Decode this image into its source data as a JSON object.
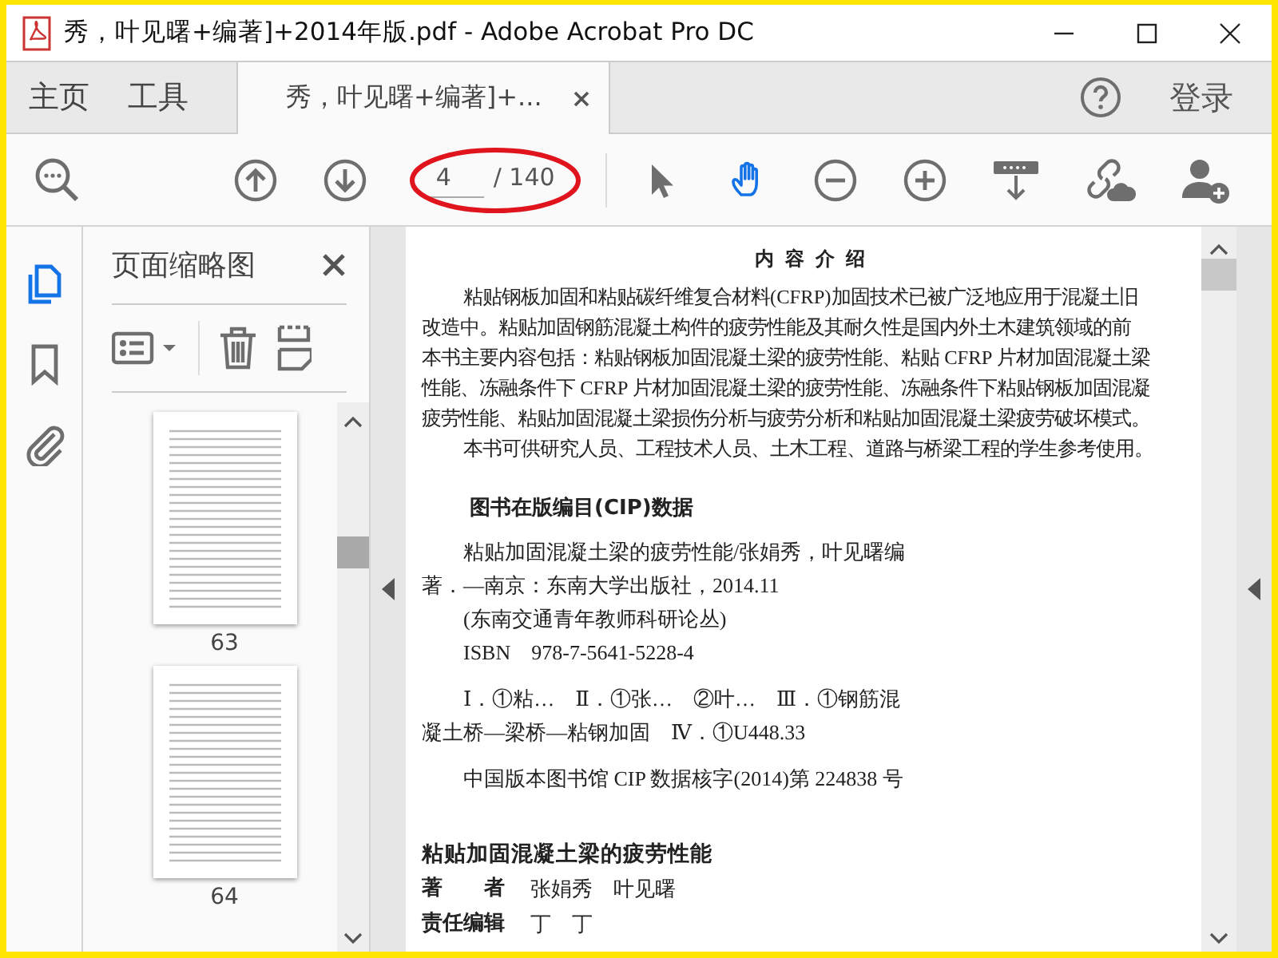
{
  "window": {
    "title": "秀，叶见曙+编著]+2014年版.pdf - Adobe Acrobat Pro DC"
  },
  "tabs": [
    {
      "kind": "home",
      "label": "主页",
      "selected": false
    },
    {
      "kind": "tools",
      "label": "工具",
      "selected": false
    },
    {
      "kind": "document",
      "label": "秀，叶见曙+编著]+...",
      "selected": true
    }
  ],
  "account": {
    "sign_in": "登录"
  },
  "toolbar": {
    "page_field": {
      "value": "4",
      "total": "/ 140"
    },
    "tools": [
      {
        "kind": "select",
        "selected": false
      },
      {
        "kind": "hand",
        "selected": true
      }
    ]
  },
  "rail": [
    {
      "kind": "pages",
      "selected": true
    },
    {
      "kind": "bookmarks",
      "selected": false
    },
    {
      "kind": "attachments",
      "selected": false
    }
  ],
  "thumbnail_panel": {
    "title": "页面缩略图",
    "thumbnails": [
      {
        "label": "63",
        "selected": false
      },
      {
        "label": "64",
        "selected": false
      }
    ]
  },
  "document": {
    "intro_heading": "内 容 介 绍",
    "intro_lines": [
      {
        "text": "粘贴钢板加固和粘贴碳纤维复合材料(CFRP)加固技术已被广泛地应用于混凝土旧",
        "indent": true
      },
      {
        "text": "改造中。粘贴加固钢筋混凝土构件的疲劳性能及其耐久性是国内外土木建筑领域的前",
        "indent": false
      },
      {
        "text": "本书主要内容包括：粘贴钢板加固混凝土梁的疲劳性能、粘贴 CFRP 片材加固混凝土梁",
        "indent": false
      },
      {
        "text": "性能、冻融条件下 CFRP 片材加固混凝土梁的疲劳性能、冻融条件下粘贴钢板加固混凝",
        "indent": false
      },
      {
        "text": "疲劳性能、粘贴加固混凝土梁损伤分析与疲劳分析和粘贴加固混凝土梁疲劳破坏模式。",
        "indent": false
      },
      {
        "text": "本书可供研究人员、工程技术人员、土木工程、道路与桥梁工程的学生参考使用。",
        "indent": true
      }
    ],
    "cip": {
      "heading": "图书在版编目(CIP)数据",
      "blocks": [
        [
          {
            "text": "粘贴加固混凝土梁的疲劳性能/张娟秀，叶见曙编",
            "indent": true
          },
          {
            "text": "著．—南京：东南大学出版社，2014.11",
            "indent": false
          },
          {
            "text": "(东南交通青年教师科研论丛)",
            "indent": true
          },
          {
            "text": "ISBN　978-7-5641-5228-4",
            "indent": true
          }
        ],
        [
          {
            "text": "Ⅰ．①粘…　Ⅱ．①张…　②叶…　Ⅲ．①钢筋混",
            "indent": true
          },
          {
            "text": "凝土桥—梁桥—粘钢加固　Ⅳ．①U448.33",
            "indent": false
          }
        ],
        [
          {
            "text": "中国版本图书馆 CIP 数据核字(2014)第 224838 号",
            "indent": true
          }
        ]
      ]
    },
    "book": {
      "title": "粘贴加固混凝土梁的疲劳性能",
      "credits": [
        {
          "role": "著　　者",
          "value": "张娟秀　叶见曙"
        },
        {
          "role": "责任编辑",
          "value": "丁　丁"
        }
      ]
    }
  }
}
